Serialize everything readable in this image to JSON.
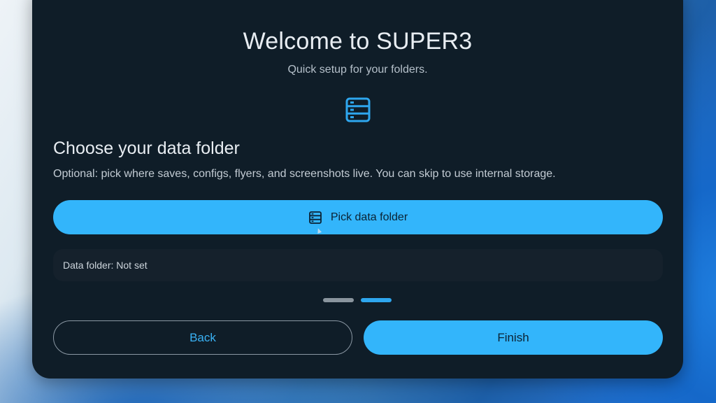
{
  "dialog": {
    "title": "Welcome to SUPER3",
    "subtitle": "Quick setup for your folders.",
    "header_icon": "storage-folder-icon"
  },
  "step": {
    "heading": "Choose your data folder",
    "description": "Optional: pick where saves, configs, flyers, and screenshots live. You can skip to use internal storage.",
    "pick_button_label": "Pick data folder",
    "pick_button_icon": "storage-folder-icon",
    "status_text": "Data folder: Not set"
  },
  "pager": {
    "total_steps": 2,
    "current_step": 2
  },
  "actions": {
    "back_label": "Back",
    "finish_label": "Finish"
  },
  "colors": {
    "accent": "#33b5fb",
    "dialog_background": "#0f1d28",
    "status_background": "#15212c",
    "pager_active": "#2ea6ee",
    "pager_inactive": "#8a959e"
  }
}
